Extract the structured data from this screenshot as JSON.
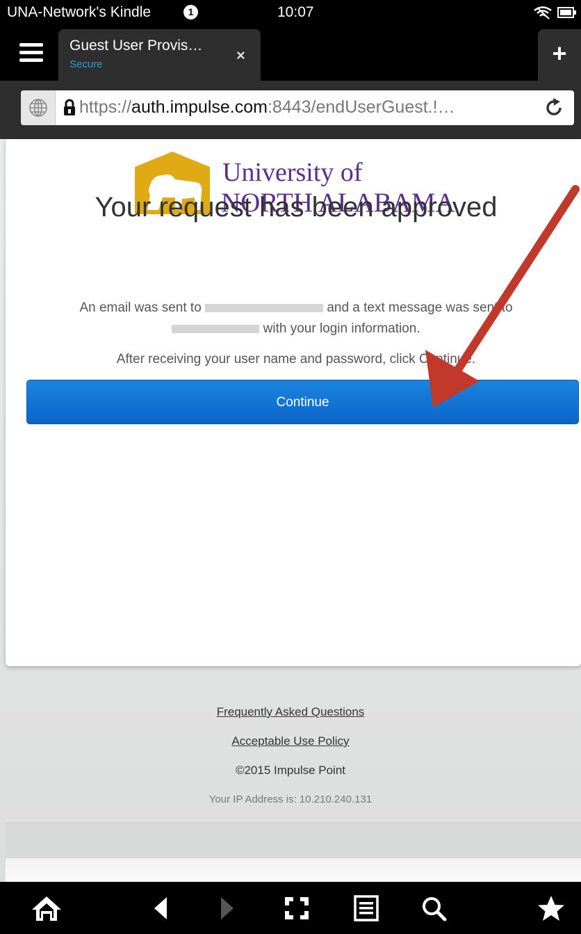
{
  "status_bar": {
    "device_name": "UNA-Network's Kindle",
    "notification_count": "1",
    "time": "10:07"
  },
  "tab": {
    "title": "Guest User Provis…",
    "subtitle": "Secure",
    "close": "×",
    "new_tab": "+"
  },
  "address": {
    "url_prefix": "https://",
    "url_host": "auth.impulse.com",
    "url_suffix": ":8443/endUserGuest.!…"
  },
  "logo": {
    "line1": "University of",
    "line2": "NORTH ALABAMA"
  },
  "content": {
    "headline": "Your request has been approved",
    "message_part1": "An email was sent to",
    "message_part2": "and a text message was sent to",
    "message_part3": "with your login information.",
    "instruction": "After receiving your user name and password, click Continue.",
    "continue_label": "Continue"
  },
  "footer": {
    "faq": "Frequently Asked Questions",
    "aup": "Acceptable Use Policy",
    "copyright": "©2015 Impulse Point",
    "ip": "Your IP Address is: 10.210.240.131"
  },
  "nav": [
    "home-icon",
    "back-icon",
    "forward-icon",
    "fullscreen-icon",
    "reading-view-icon",
    "search-icon",
    "favorites-icon"
  ],
  "colors": {
    "accent_blue": "#0a66c8",
    "una_gold": "#e0aa14",
    "una_purple": "#5b2d8e",
    "annotation_red": "#c0392b"
  }
}
